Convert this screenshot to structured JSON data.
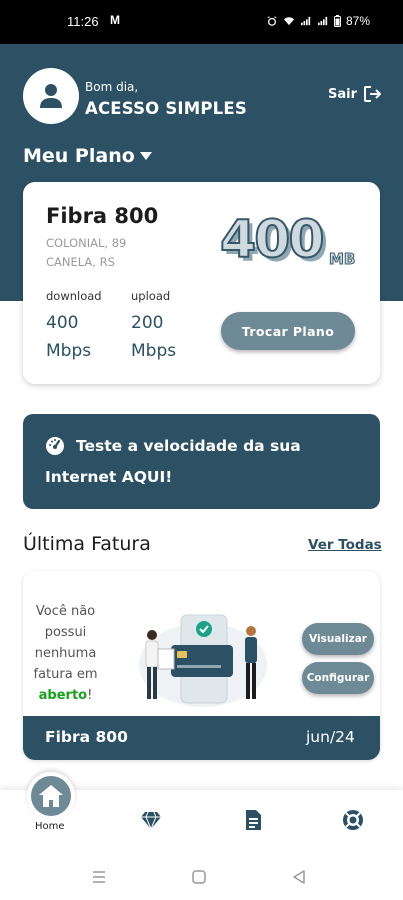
{
  "status_bar": {
    "time": "11:26",
    "carrier_icon": "M",
    "battery": "87%"
  },
  "header": {
    "greeting": "Bom dia,",
    "username": "ACESSO SIMPLES",
    "logout_label": "Sair",
    "plan_section_title": "Meu Plano"
  },
  "plan": {
    "name": "Fibra 800",
    "address_line1": "COLONIAL, 89",
    "address_line2": "CANELA, RS",
    "speed_number": "400",
    "speed_unit": "MB",
    "download_label": "download",
    "download_value": "400",
    "download_unit": "Mbps",
    "upload_label": "upload",
    "upload_value": "200",
    "upload_unit": "Mbps",
    "change_plan_button": "Trocar Plano"
  },
  "speed_test": {
    "line1": "Teste a velocidade da sua",
    "line2": "Internet AQUI!"
  },
  "invoice": {
    "section_title": "Última Fatura",
    "see_all": "Ver Todas",
    "empty_text_1": "Você não possui nenhuma fatura em",
    "empty_text_highlight": "aberto",
    "empty_text_end": "!",
    "view_button": "Visualizar",
    "configure_button": "Configurar",
    "plan_name": "Fibra 800",
    "month": "jun/24"
  },
  "bottom_nav": {
    "items": [
      {
        "label": "Home",
        "icon": "home-icon"
      },
      {
        "label": "",
        "icon": "diamond-icon"
      },
      {
        "label": "",
        "icon": "document-icon"
      },
      {
        "label": "",
        "icon": "support-icon"
      }
    ]
  },
  "colors": {
    "primary": "#2c5165",
    "button": "#6f8a97",
    "accent_green": "#16a31a"
  }
}
